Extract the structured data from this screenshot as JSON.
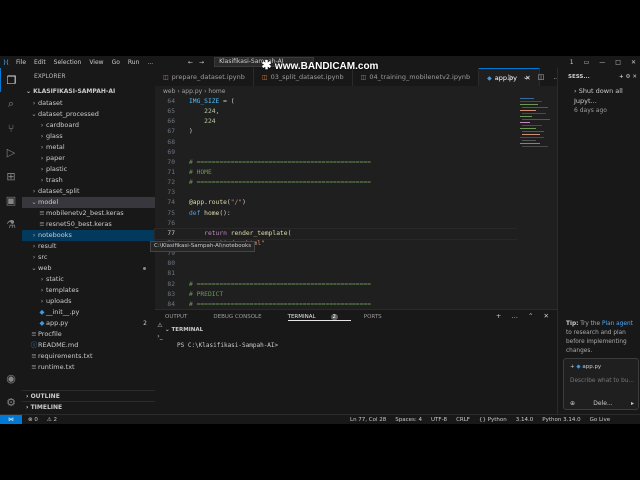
{
  "watermark": "www.BANDICAM.com",
  "titlebar": {
    "menu": [
      "File",
      "Edit",
      "Selection",
      "View",
      "Go",
      "Run",
      "..."
    ],
    "search": "Klasifikasi-Sampah-AI",
    "notif": "1"
  },
  "sidebar": {
    "title": "EXPLORER",
    "root": "KLASIFIKASI-SAMPAH-AI",
    "items": [
      {
        "label": "dataset",
        "indent": 0,
        "chev": "›"
      },
      {
        "label": "dataset_processed",
        "indent": 0,
        "chev": "⌄"
      },
      {
        "label": "cardboard",
        "indent": 1,
        "chev": "›"
      },
      {
        "label": "glass",
        "indent": 1,
        "chev": "›"
      },
      {
        "label": "metal",
        "indent": 1,
        "chev": "›"
      },
      {
        "label": "paper",
        "indent": 1,
        "chev": "›"
      },
      {
        "label": "plastic",
        "indent": 1,
        "chev": "›"
      },
      {
        "label": "trash",
        "indent": 1,
        "chev": "›"
      },
      {
        "label": "dataset_split",
        "indent": 0,
        "chev": "›"
      },
      {
        "label": "model",
        "indent": 0,
        "chev": "⌄"
      },
      {
        "label": "mobilenetv2_best.keras",
        "indent": 1,
        "chev": "≡"
      },
      {
        "label": "resnet50_best.keras",
        "indent": 1,
        "chev": "≡"
      },
      {
        "label": "notebooks",
        "indent": 0,
        "chev": "›"
      },
      {
        "label": "result",
        "indent": 0,
        "chev": "›"
      },
      {
        "label": "src",
        "indent": 0,
        "chev": "›"
      },
      {
        "label": "web",
        "indent": 0,
        "chev": "⌄"
      },
      {
        "label": "static",
        "indent": 1,
        "chev": "›"
      },
      {
        "label": "templates",
        "indent": 1,
        "chev": "›"
      },
      {
        "label": "uploads",
        "indent": 1,
        "chev": "›"
      },
      {
        "label": "__init__.py",
        "indent": 1,
        "chev": "◆"
      },
      {
        "label": "app.py",
        "indent": 1,
        "chev": "◆",
        "badge": "2"
      },
      {
        "label": "Procfile",
        "indent": 0,
        "chev": "≡"
      },
      {
        "label": "README.md",
        "indent": 0,
        "chev": "ⓘ"
      },
      {
        "label": "requirements.txt",
        "indent": 0,
        "chev": "≡"
      },
      {
        "label": "runtime.txt",
        "indent": 0,
        "chev": "≡"
      }
    ],
    "tooltip": "C:\\Klasifikasi-Sampah-AI\\notebooks",
    "outline": "OUTLINE",
    "timeline": "TIMELINE"
  },
  "tabs": [
    {
      "label": "prepare_dataset.ipynb",
      "type": "nb"
    },
    {
      "label": "03_split_dataset.ipynb",
      "type": "nb"
    },
    {
      "label": "04_training_mobilenetv2.ipynb",
      "type": "nb"
    },
    {
      "label": "app.py",
      "type": "py",
      "active": true
    }
  ],
  "breadcrumb": "web  ›  app.py  ›  home",
  "code": [
    {
      "n": "64",
      "html": "<span class='k-var'>IMG_SIZE</span> <span class='k-p'>= (</span>"
    },
    {
      "n": "65",
      "html": "    <span class='k-num'>224</span><span class='k-p'>,</span>"
    },
    {
      "n": "66",
      "html": "    <span class='k-num'>224</span>"
    },
    {
      "n": "67",
      "html": "<span class='k-p'>)</span>"
    },
    {
      "n": "68",
      "html": ""
    },
    {
      "n": "69",
      "html": ""
    },
    {
      "n": "70",
      "html": "<span class='k-com'># ==============================================</span>"
    },
    {
      "n": "71",
      "html": "<span class='k-com'># HOME</span>"
    },
    {
      "n": "72",
      "html": "<span class='k-com'># ==============================================</span>"
    },
    {
      "n": "73",
      "html": ""
    },
    {
      "n": "74",
      "html": "<span class='k-dec'>@app.route</span><span class='k-p'>(</span><span class='k-str'>\"/\"</span><span class='k-p'>)</span>"
    },
    {
      "n": "75",
      "html": "<span class='k-def'>def</span> <span class='k-fn'>home</span><span class='k-p'>():</span>"
    },
    {
      "n": "76",
      "html": ""
    },
    {
      "n": "77",
      "html": "    <span class='k-kw'>return</span> <span class='k-fn'>render_template</span><span class='k-p'>(</span>",
      "cur": true
    },
    {
      "n": "78",
      "html": "        <span class='k-str'>\"index.html\"</span>"
    },
    {
      "n": "79",
      "html": ""
    },
    {
      "n": "80",
      "html": ""
    },
    {
      "n": "81",
      "html": ""
    },
    {
      "n": "82",
      "html": "<span class='k-com'># ==============================================</span>"
    },
    {
      "n": "83",
      "html": "<span class='k-com'># PREDICT</span>"
    },
    {
      "n": "84",
      "html": "<span class='k-com'># ==============================================</span>"
    },
    {
      "n": "85",
      "html": ""
    }
  ],
  "panel": {
    "tabs": [
      "OUTPUT",
      "DEBUG CONSOLE",
      "TERMINAL",
      "PORTS"
    ],
    "terminal_count": "2",
    "terminal_header": "TERMINAL",
    "prompt": "PS C:\\Klasifikasi-Sampah-AI>"
  },
  "chat": {
    "header": "SESS...",
    "session_title": "Shut down all Jupyt...",
    "session_time": "6 days ago",
    "tip_prefix": "Tip:",
    "tip_text_1": " Try the ",
    "tip_link": "Plan agent",
    "tip_text_2": " to research and plan before implementing changes.",
    "attachment": "app.py",
    "placeholder": "Describe what to bu...",
    "mode": "Dele..."
  },
  "status": {
    "left": [
      "⊗ 0",
      "⚠ 2"
    ],
    "right": [
      "Ln 77, Col 28",
      "Spaces: 4",
      "UTF-8",
      "CRLF",
      "{} Python",
      "3.14.0",
      "Python 3.14.0",
      "Go Live"
    ]
  }
}
